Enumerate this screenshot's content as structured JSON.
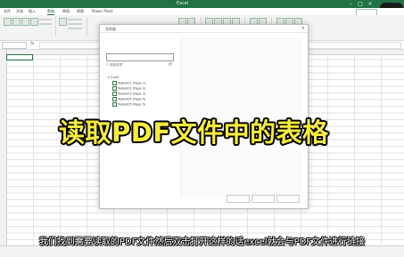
{
  "app": {
    "title": "Excel"
  },
  "ribbon": {
    "tabs": [
      "文件",
      "开始",
      "插入",
      "数据",
      "审阅",
      "视图",
      "Power Pivot"
    ],
    "active_tab": "数据"
  },
  "dialog": {
    "title": "导航器",
    "multi_select_label": "选择多项",
    "file_name": "2.pdf",
    "items": [
      "Table001 (Page 1)",
      "Table002 (Page 2)",
      "Table003 (Page 3)",
      "Table004 (Page 4)",
      "Table005 (Page 5)"
    ],
    "refresh_icon": "refresh-icon",
    "close_icon": "close-icon"
  },
  "overlay": {
    "caption": "读取PDF文件中的表格",
    "subtitle": "我们找到需要读取的PDF文件然后双击打开这样的话excel就会与PDF文件进行链接",
    "caption_color": "#f6ec3d"
  },
  "colors": {
    "accent": "#207245"
  }
}
